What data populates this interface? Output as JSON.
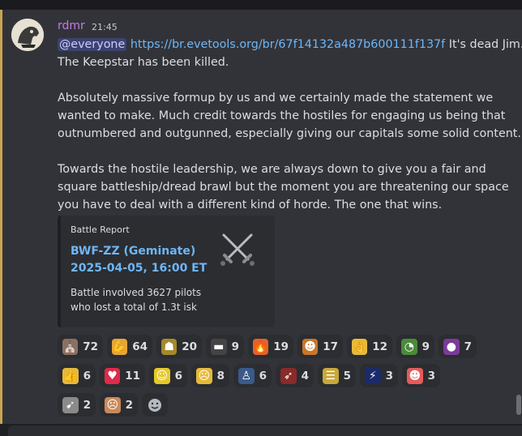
{
  "message": {
    "username": "rdmr",
    "timestamp": "21:45",
    "mention": "@everyone",
    "link": "https://br.evetools.org/br/67f14132a487b600111f137f",
    "line1_rest": " It's dead Jim.",
    "line2": "The Keepstar has been killed.",
    "para2": [
      "Absolutely massive formup by us and we certainly made the statement we",
      "wanted to make. Much credit towards the hostiles for engaging us being that",
      "outnumbered and outgunned, especially giving our capitals some solid content."
    ],
    "para3": [
      "Towards the hostile leadership, we are always down to give you a fair and",
      "square battleship/dread brawl but the moment you are threatening our space",
      "you have to deal with a different kind of horde. The one that wins."
    ]
  },
  "embed": {
    "provider": "Battle Report",
    "title_line1": "BWF-ZZ (Geminate)",
    "title_line2": "2025-04-05, 16:00 ET",
    "desc_line1": "Battle involved 3627 pilots",
    "desc_line2": "who lost a total of 1.3t isk",
    "thumbnail_icon": "crossed-swords-icon"
  },
  "reactions": [
    {
      "icon": "pope-emoji",
      "glyph": "⛪",
      "bg": "#8a7060",
      "count": "72"
    },
    {
      "icon": "flexed-biceps-emoji",
      "glyph": "💪",
      "bg": "#e6a53a",
      "count": "64"
    },
    {
      "icon": "goblin-emoji",
      "glyph": "☗",
      "bg": "#a58a2a",
      "count": "20"
    },
    {
      "icon": "gun-emoji",
      "glyph": "▬",
      "bg": "#444444",
      "count": "9"
    },
    {
      "icon": "fire-emoji",
      "glyph": "🔥",
      "bg": "#e6612a",
      "count": "19"
    },
    {
      "icon": "screaming-dog-emoji",
      "glyph": "☻",
      "bg": "#c9752a",
      "count": "17"
    },
    {
      "icon": "ok-hand-emoji",
      "glyph": "👌",
      "bg": "#e6b93a",
      "count": "12"
    },
    {
      "icon": "frog-emoji",
      "glyph": "◔",
      "bg": "#4a8a3a",
      "count": "9"
    },
    {
      "icon": "eggplant-emoji",
      "glyph": "●",
      "bg": "#7a3a9a",
      "count": "7"
    },
    {
      "icon": "thumbs-up-emoji",
      "glyph": "👍",
      "bg": "#e6b93a",
      "count": "6"
    },
    {
      "icon": "heart-face-emoji",
      "glyph": "♥",
      "bg": "#e02a4a",
      "count": "11"
    },
    {
      "icon": "smiley-emoji",
      "glyph": "☺",
      "bg": "#e6c92a",
      "count": "6"
    },
    {
      "icon": "sweating-face-emoji",
      "glyph": "☹",
      "bg": "#e6b93a",
      "count": "8"
    },
    {
      "icon": "person-raising-arms-emoji",
      "glyph": "♙",
      "bg": "#3a5a8a",
      "count": "6"
    },
    {
      "icon": "rocket-emoji",
      "glyph": "➶",
      "bg": "#8a2a2a",
      "count": "4"
    },
    {
      "icon": "dog-meme-emoji",
      "glyph": "☰",
      "bg": "#c9a83a",
      "count": "5"
    },
    {
      "icon": "lightning-emoji",
      "glyph": "⚡",
      "bg": "#1a2a6a",
      "count": "3"
    },
    {
      "icon": "clown-face-emoji",
      "glyph": "☻",
      "bg": "#e65a5a",
      "count": "3"
    },
    {
      "icon": "arrow-ship-emoji",
      "glyph": "➹",
      "bg": "#8a8a8a",
      "count": "2"
    },
    {
      "icon": "screaming-face-emoji",
      "glyph": "☹",
      "bg": "#c98a5a",
      "count": "2"
    }
  ],
  "add_reaction_icon": "add-reaction-icon"
}
